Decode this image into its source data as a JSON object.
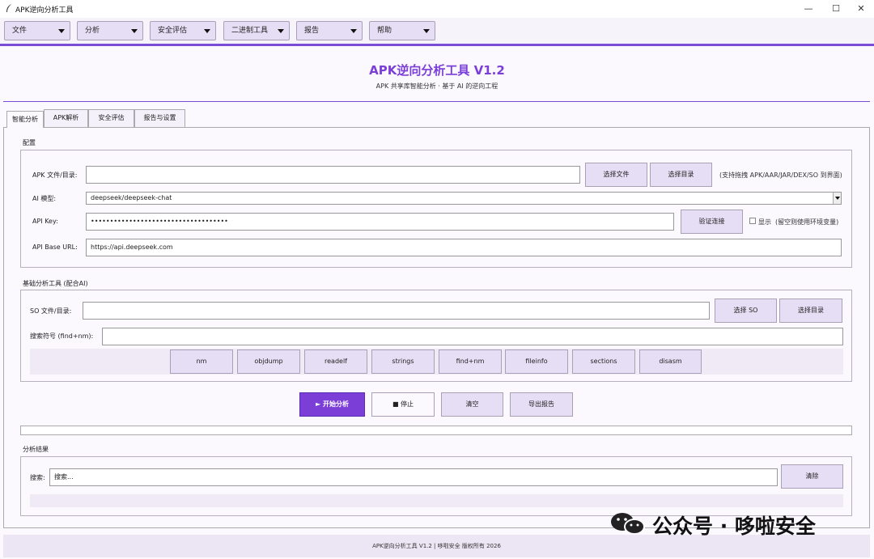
{
  "window": {
    "title": "APK逆向分析工具",
    "controls": [
      "—",
      "☐",
      "✕"
    ]
  },
  "menus": [
    "文件",
    "分析",
    "安全评估",
    "二进制工具",
    "报告",
    "帮助"
  ],
  "header": {
    "title": "APK逆向分析工具 V1.2",
    "subtitle": "APK 共享库智能分析 · 基于 AI 的逆向工程"
  },
  "tabs": [
    "智能分析",
    "APK解析",
    "安全评估",
    "报告与设置"
  ],
  "config": {
    "group_label": "配置",
    "apk_label": "APK 文件/目录:",
    "apk_value": "",
    "select_file": "选择文件",
    "select_dir": "选择目录",
    "drag_hint": "(支持拖拽 APK/AAR/JAR/DEX/SO 到界面)",
    "model_label": "AI 模型:",
    "model_value": "deepseek/deepseek-chat",
    "key_label": "API Key:",
    "key_value": "••••••••••••••••••••••••••••••••••••",
    "verify_button": "验证连接",
    "show_label": "显示",
    "env_hint": "(留空则使用环境变量)",
    "base_url_label": "API Base URL:",
    "base_url_value": "https://api.deepseek.com"
  },
  "tools": {
    "group_label": "基础分析工具 (配合AI)",
    "so_label": "SO 文件/目录:",
    "so_value": "",
    "select_so": "选择 SO",
    "select_dir": "选择目录",
    "symbol_label": "搜索符号 (find+nm):",
    "symbol_value": "",
    "buttons": [
      "nm",
      "objdump",
      "readelf",
      "strings",
      "find+nm",
      "fileinfo",
      "sections",
      "disasm"
    ]
  },
  "actions": {
    "start": "► 开始分析",
    "stop": "■ 停止",
    "clear": "清空",
    "export": "导出报告"
  },
  "results": {
    "group_label": "分析结果",
    "search_label": "搜索:",
    "search_placeholder": "搜索...",
    "clear_button": "清除"
  },
  "footer": {
    "text": "APK逆向分析工具 V1.2 | 哆啦安全 版权所有 2026"
  },
  "watermark": {
    "text": "公众号 · 哆啦安全"
  }
}
